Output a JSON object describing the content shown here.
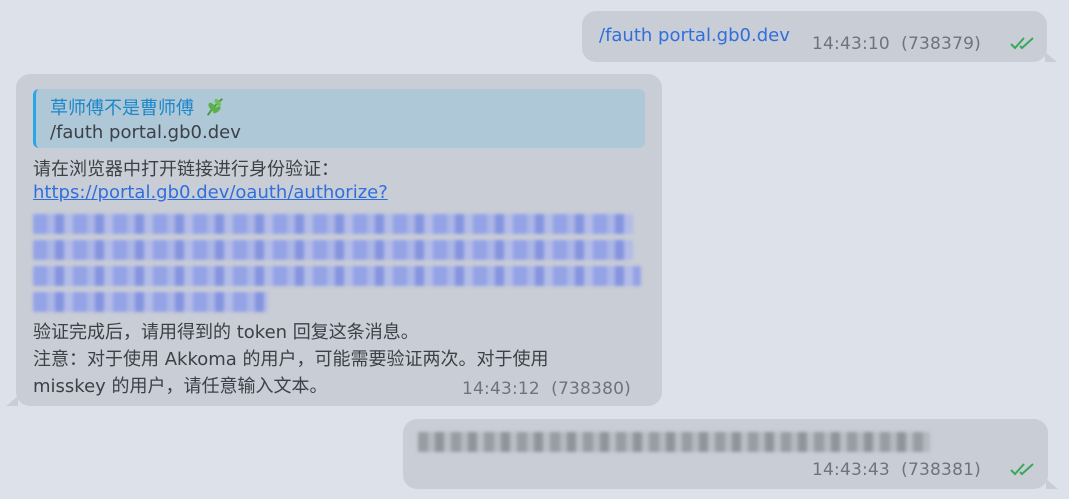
{
  "messages": [
    {
      "direction": "outgoing",
      "text": "/fauth portal.gb0.dev",
      "time": "14:43:10",
      "id": "(738379)",
      "status_icon": "double-check-icon"
    },
    {
      "direction": "incoming",
      "reply": {
        "author": "草师傅不是曹师傅",
        "author_icon": "leaf-emoji-icon",
        "quoted_text": "/fauth portal.gb0.dev"
      },
      "lines": {
        "intro": "请在浏览器中打开链接进行身份验证：",
        "link": "https://portal.gb0.dev/oauth/authorize?",
        "after": "验证完成后，请用得到的 token 回复这条消息。",
        "note_1": "注意：对于使用 Akkoma 的用户，可能需要验证两次。对于使用",
        "note_2": "misskey 的用户，请任意输入文本。"
      },
      "redacted_link_lines": 4,
      "time": "14:43:12",
      "id": "(738380)"
    },
    {
      "direction": "outgoing",
      "redacted_text": true,
      "time": "14:43:43",
      "id": "(738381)",
      "status_icon": "double-check-icon"
    }
  ],
  "colors": {
    "background": "#dde1e9",
    "bubble": "#c9cdd6",
    "link": "#2f6fdc",
    "reply_accent": "#29a6e6",
    "reply_bg": "#aec8d8",
    "read_check": "#3aa85a"
  }
}
